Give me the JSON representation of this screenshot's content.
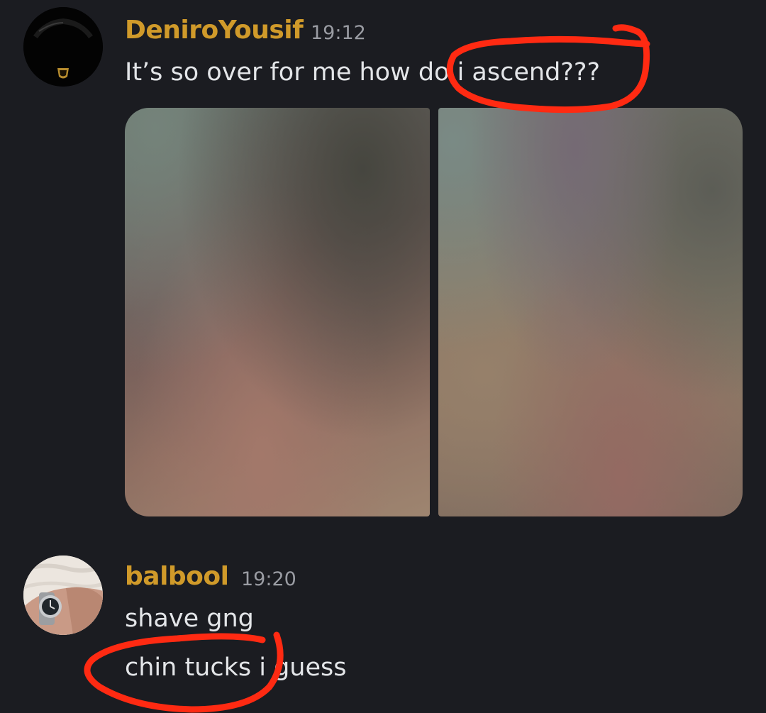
{
  "messages": [
    {
      "author": "DeniroYousif",
      "time": "19:12",
      "lines": [
        "It’s so over for me how do i ascend???"
      ],
      "attachments": [
        "blurred-photo-1",
        "blurred-photo-2"
      ]
    },
    {
      "author": "balbool",
      "time": "19:20",
      "lines": [
        "shave gng",
        "chin tucks i guess"
      ]
    }
  ],
  "colors": {
    "background": "#1b1c21",
    "username": "#d09a2a",
    "timestamp": "#9a9ca3",
    "message_text": "#e3e5e8",
    "annotation": "#ff2a12"
  }
}
